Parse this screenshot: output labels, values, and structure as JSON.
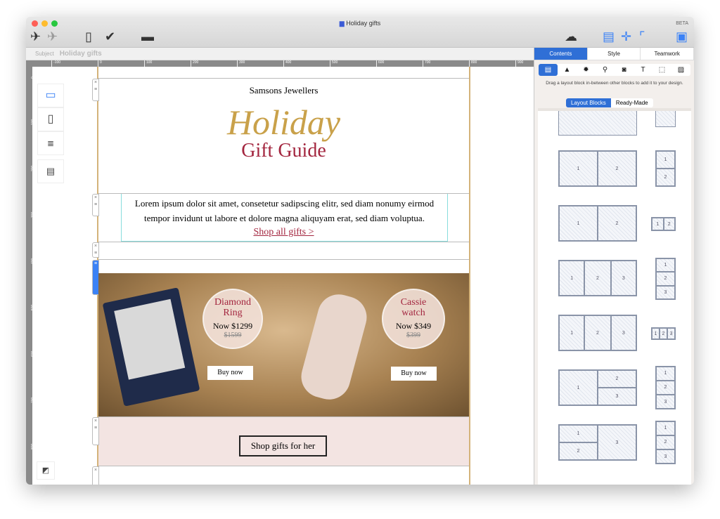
{
  "window": {
    "title": "Holiday gifts",
    "beta": "BETA"
  },
  "subject": {
    "label": "Subject",
    "value": "Holiday gifts"
  },
  "ruler": {
    "h_ticks": [
      "-100",
      "0",
      "100",
      "200",
      "300",
      "400",
      "500",
      "600",
      "700",
      "800",
      "900"
    ],
    "v_ticks": [
      "0",
      "100",
      "200",
      "300",
      "400",
      "500",
      "600",
      "700",
      "800"
    ]
  },
  "email": {
    "brand": "Samsons Jewellers",
    "headline": "Holiday",
    "subheadline": "Gift Guide",
    "body": "Lorem ipsum dolor sit amet, consetetur sadipscing elitr, sed diam nonumy eirmod tempor invidunt ut labore et dolore magna aliquyam erat, sed diam voluptua.",
    "shop_all": "Shop all gifts >",
    "products": [
      {
        "name": "Diamond Ring",
        "price": "Now $1299",
        "old_price": "$1599",
        "button": "Buy now"
      },
      {
        "name": "Cassie watch",
        "price": "Now $349",
        "old_price": "$399",
        "button": "Buy now"
      }
    ],
    "shop_her": "Shop gifts for her",
    "colors": {
      "accent": "#a3263f",
      "gold": "#c9a14a",
      "pink_bg": "#f3e4e2"
    }
  },
  "sidebar": {
    "tabs": [
      "Contents",
      "Style",
      "Teamwork"
    ],
    "hint": "Drag a layout block in-between other blocks to add it to your design.",
    "segments": [
      "Layout Blocks",
      "Ready-Made"
    ],
    "accent": "#2f6fd6"
  },
  "layout_labels": {
    "one": "1",
    "two": "2",
    "three": "3"
  }
}
